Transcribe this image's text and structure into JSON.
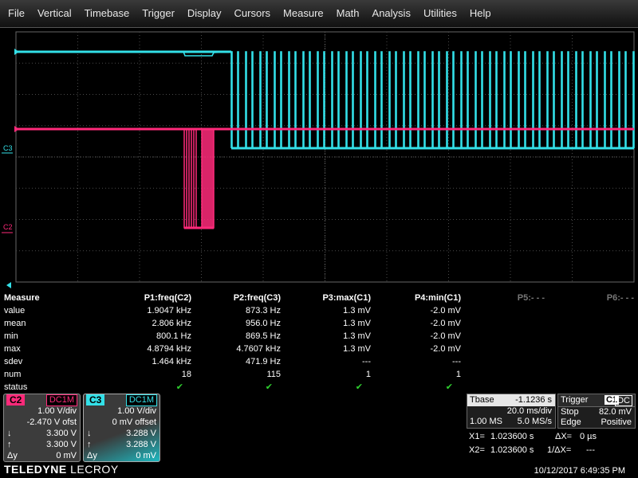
{
  "menu": [
    "File",
    "Vertical",
    "Timebase",
    "Trigger",
    "Display",
    "Cursors",
    "Measure",
    "Math",
    "Analysis",
    "Utilities",
    "Help"
  ],
  "grid": {
    "c3_marker": "C3",
    "c2_marker": "C2",
    "colors": {
      "c3": "#33e0e8",
      "c2": "#ff2a7a",
      "grid": "#4a4a4a"
    }
  },
  "measure": {
    "title": "Measure",
    "params": [
      "P1:freq(C2)",
      "P2:freq(C3)",
      "P3:max(C1)",
      "P4:min(C1)",
      "P5:- - -",
      "P6:- - -"
    ],
    "rows": [
      {
        "label": "value",
        "cells": [
          "1.9047 kHz",
          "873.3 Hz",
          "1.3 mV",
          "-2.0 mV"
        ]
      },
      {
        "label": "mean",
        "cells": [
          "2.806 kHz",
          "956.0 Hz",
          "1.3 mV",
          "-2.0 mV"
        ]
      },
      {
        "label": "min",
        "cells": [
          "800.1 Hz",
          "869.5 Hz",
          "1.3 mV",
          "-2.0 mV"
        ]
      },
      {
        "label": "max",
        "cells": [
          "4.8794 kHz",
          "4.7607 kHz",
          "1.3 mV",
          "-2.0 mV"
        ]
      },
      {
        "label": "sdev",
        "cells": [
          "1.464 kHz",
          "471.9 Hz",
          "---",
          "---"
        ]
      },
      {
        "label": "num",
        "cells": [
          "18",
          "115",
          "1",
          "1"
        ]
      },
      {
        "label": "status",
        "cells": [
          "✔",
          "✔",
          "✔",
          "✔"
        ]
      }
    ]
  },
  "c2": {
    "tag": "C2",
    "coupling": "DC1M",
    "vdiv": "1.00 V/div",
    "offset": "-2.470 V ofst",
    "down": "3.300 V",
    "up": "3.300 V",
    "dy_label": "Δy",
    "dy": "0 mV",
    "down_icon": "↓",
    "up_icon": "↑",
    "color": "#ff2a7a"
  },
  "c3": {
    "tag": "C3",
    "coupling": "DC1M",
    "vdiv": "1.00 V/div",
    "offset": "0 mV offset",
    "down": "3.288 V",
    "up": "3.288 V",
    "dy_label": "Δy",
    "dy": "0 mV",
    "down_icon": "↓",
    "up_icon": "↑",
    "color": "#33e0e8"
  },
  "tbase": {
    "label": "Tbase",
    "value": "-1.1236 s",
    "tdiv": "20.0 ms/div",
    "samples": "1.00 MS",
    "rate": "5.0 MS/s"
  },
  "trigger": {
    "label": "Trigger",
    "chan": "C1",
    "coup": "DC",
    "mode": "Stop",
    "level": "82.0 mV",
    "type": "Edge",
    "slope": "Positive"
  },
  "cursors": {
    "x1_label": "X1=",
    "x1": "1.023600 s",
    "dx_label": "ΔX=",
    "dx": "0 µs",
    "x2_label": "X2=",
    "x2": "1.023600 s",
    "inv_label": "1/ΔX=",
    "inv": "---"
  },
  "brand": {
    "bold": "TELEDYNE",
    "thin": "LECROY"
  },
  "datetime": "10/12/2017 6:49:35 PM"
}
